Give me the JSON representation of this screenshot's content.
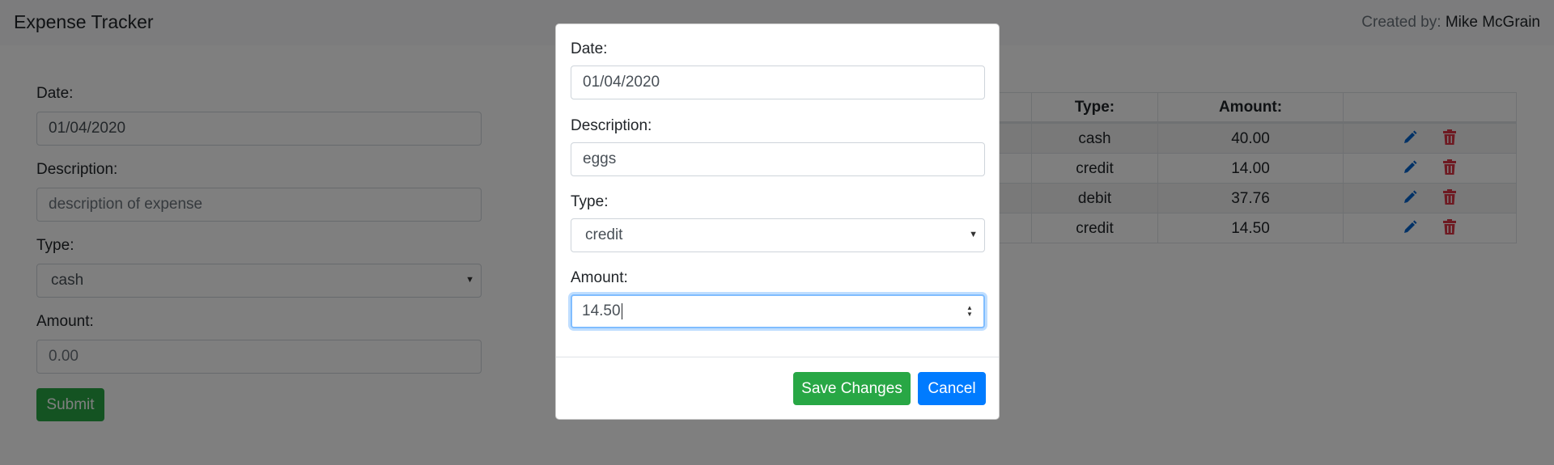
{
  "navbar": {
    "title": "Expense Tracker",
    "created_by_label": "Created by:",
    "author": "Mike McGrain"
  },
  "form": {
    "date_label": "Date:",
    "date_value": "01/04/2020",
    "description_label": "Description:",
    "description_placeholder": "description of expense",
    "type_label": "Type:",
    "type_value": "cash",
    "amount_label": "Amount:",
    "amount_placeholder": "0.00",
    "submit_label": "Submit"
  },
  "table": {
    "headers": [
      "Type:",
      "Amount:"
    ],
    "rows": [
      {
        "type": "cash",
        "amount": "40.00"
      },
      {
        "type": "credit",
        "amount": "14.00"
      },
      {
        "type": "debit",
        "amount": "37.76"
      },
      {
        "type": "credit",
        "amount": "14.50"
      }
    ]
  },
  "modal": {
    "date_label": "Date:",
    "date_value": "01/04/2020",
    "description_label": "Description:",
    "description_value": "eggs",
    "type_label": "Type:",
    "type_value": "credit",
    "amount_label": "Amount:",
    "amount_value": "14.50",
    "save_label": "Save Changes",
    "cancel_label": "Cancel"
  },
  "icons": {
    "edit": "pencil-icon",
    "delete": "trash-icon"
  },
  "colors": {
    "success": "#28a745",
    "primary": "#007bff",
    "danger": "#dc3545",
    "edit_icon": "#0062cc"
  }
}
